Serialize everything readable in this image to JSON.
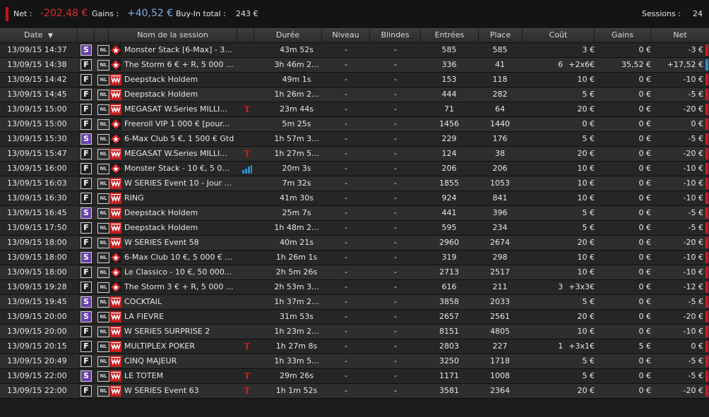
{
  "summary": {
    "net_label": "Net :",
    "net_value": "-202,48 €",
    "gains_label": "Gains :",
    "gains_value": "+40,52 €",
    "buyin_label": "Buy-In total :",
    "buyin_value": "243 €",
    "sessions_label": "Sessions :",
    "sessions_value": "24"
  },
  "columns": {
    "date": "Date",
    "sort_icon": "▼",
    "name": "Nom de la session",
    "duration": "Durée",
    "level": "Niveau",
    "blinds": "Blindes",
    "entries": "Entrées",
    "place": "Place",
    "cost": "Coût",
    "gains": "Gains",
    "net": "Net"
  },
  "colors": {
    "negative": "#d21c1c",
    "positive": "#2a8fd6",
    "special_badge": "#6a40a8"
  },
  "rows": [
    {
      "date": "13/09/15 14:37",
      "type": "S",
      "nl": "NL",
      "room": "pokerstars-icon",
      "name": "Monster Stack [6-Max] - 3...",
      "flag": "",
      "duration": "43m 52s",
      "level": "-",
      "blinds": "-",
      "entries": "585",
      "place": "585",
      "cost_prefix": "",
      "cost": "3 €",
      "gains": "0 €",
      "net": "-3 €",
      "net_bar": "red"
    },
    {
      "date": "13/09/15 14:38",
      "type": "F",
      "nl": "NL",
      "room": "pokerstars-icon",
      "name": "The Storm 6 € + R, 5 000 ...",
      "flag": "",
      "duration": "3h 46m 2...",
      "level": "-",
      "blinds": "-",
      "entries": "336",
      "place": "41",
      "cost_prefix": "6",
      "cost": "+2x6€",
      "gains": "35,52 €",
      "net": "+17,52 €",
      "net_bar": "blue"
    },
    {
      "date": "13/09/15 14:42",
      "type": "F",
      "nl": "NL",
      "room": "winamax-icon",
      "name": "Deepstack Holdem",
      "flag": "",
      "duration": "49m 1s",
      "level": "-",
      "blinds": "-",
      "entries": "153",
      "place": "118",
      "cost_prefix": "",
      "cost": "10 €",
      "gains": "0 €",
      "net": "-10 €",
      "net_bar": "red"
    },
    {
      "date": "13/09/15 14:45",
      "type": "F",
      "nl": "NL",
      "room": "winamax-icon",
      "name": "Deepstack Holdem",
      "flag": "",
      "duration": "1h 26m 2...",
      "level": "-",
      "blinds": "-",
      "entries": "444",
      "place": "282",
      "cost_prefix": "",
      "cost": "5 €",
      "gains": "0 €",
      "net": "-5 €",
      "net_bar": "red"
    },
    {
      "date": "13/09/15 15:00",
      "type": "F",
      "nl": "NL",
      "room": "winamax-icon",
      "name": "MEGASAT W.Series MILLI...",
      "flag": "T",
      "duration": "23m 44s",
      "level": "-",
      "blinds": "-",
      "entries": "71",
      "place": "64",
      "cost_prefix": "",
      "cost": "20 €",
      "gains": "0 €",
      "net": "-20 €",
      "net_bar": "red"
    },
    {
      "date": "13/09/15 15:00",
      "type": "F",
      "nl": "NL",
      "room": "pokerstars-icon",
      "name": "Freeroll VIP 1 000 € [pour...",
      "flag": "",
      "duration": "5m 25s",
      "level": "-",
      "blinds": "-",
      "entries": "1456",
      "place": "1440",
      "cost_prefix": "",
      "cost": "0 €",
      "gains": "0 €",
      "net": "0 €",
      "net_bar": "red"
    },
    {
      "date": "13/09/15 15:30",
      "type": "S",
      "nl": "NL",
      "room": "pokerstars-icon",
      "name": "6-Max Club 5 €, 1 500 € Gtd",
      "flag": "",
      "duration": "1h 57m 3...",
      "level": "-",
      "blinds": "-",
      "entries": "229",
      "place": "176",
      "cost_prefix": "",
      "cost": "5 €",
      "gains": "0 €",
      "net": "-5 €",
      "net_bar": "red"
    },
    {
      "date": "13/09/15 15:47",
      "type": "F",
      "nl": "NL",
      "room": "winamax-icon",
      "name": "MEGASAT W.Series MILLI...",
      "flag": "T",
      "duration": "1h 27m 5...",
      "level": "-",
      "blinds": "-",
      "entries": "124",
      "place": "38",
      "cost_prefix": "",
      "cost": "20 €",
      "gains": "0 €",
      "net": "-20 €",
      "net_bar": "red"
    },
    {
      "date": "13/09/15 16:00",
      "type": "F",
      "nl": "NL",
      "room": "pokerstars-icon",
      "name": "Monster Stack - 10 €, 5 0...",
      "flag": "chart",
      "duration": "20m 3s",
      "level": "-",
      "blinds": "-",
      "entries": "206",
      "place": "206",
      "cost_prefix": "",
      "cost": "10 €",
      "gains": "0 €",
      "net": "-10 €",
      "net_bar": "red"
    },
    {
      "date": "13/09/15 16:03",
      "type": "F",
      "nl": "NL",
      "room": "winamax-icon",
      "name": "W SERIES Event 10 - Jour ...",
      "flag": "",
      "duration": "7m 32s",
      "level": "-",
      "blinds": "-",
      "entries": "1855",
      "place": "1053",
      "cost_prefix": "",
      "cost": "10 €",
      "gains": "0 €",
      "net": "-10 €",
      "net_bar": "red"
    },
    {
      "date": "13/09/15 16:30",
      "type": "F",
      "nl": "NL",
      "room": "winamax-icon",
      "name": "RING",
      "flag": "",
      "duration": "41m 30s",
      "level": "-",
      "blinds": "-",
      "entries": "924",
      "place": "841",
      "cost_prefix": "",
      "cost": "10 €",
      "gains": "0 €",
      "net": "-10 €",
      "net_bar": "red"
    },
    {
      "date": "13/09/15 16:45",
      "type": "S",
      "nl": "NL",
      "room": "winamax-icon",
      "name": "Deepstack Holdem",
      "flag": "",
      "duration": "25m 7s",
      "level": "-",
      "blinds": "-",
      "entries": "441",
      "place": "396",
      "cost_prefix": "",
      "cost": "5 €",
      "gains": "0 €",
      "net": "-5 €",
      "net_bar": "red"
    },
    {
      "date": "13/09/15 17:50",
      "type": "F",
      "nl": "NL",
      "room": "winamax-icon",
      "name": "Deepstack Holdem",
      "flag": "",
      "duration": "1h 48m 2...",
      "level": "-",
      "blinds": "-",
      "entries": "595",
      "place": "234",
      "cost_prefix": "",
      "cost": "5 €",
      "gains": "0 €",
      "net": "-5 €",
      "net_bar": "red"
    },
    {
      "date": "13/09/15 18:00",
      "type": "F",
      "nl": "NL",
      "room": "winamax-icon",
      "name": "W SERIES Event 58",
      "flag": "",
      "duration": "40m 21s",
      "level": "-",
      "blinds": "-",
      "entries": "2960",
      "place": "2674",
      "cost_prefix": "",
      "cost": "20 €",
      "gains": "0 €",
      "net": "-20 €",
      "net_bar": "red"
    },
    {
      "date": "13/09/15 18:00",
      "type": "S",
      "nl": "NL",
      "room": "pokerstars-icon",
      "name": "6-Max Club 10 €, 5 000 € ...",
      "flag": "",
      "duration": "1h 26m 1s",
      "level": "-",
      "blinds": "-",
      "entries": "319",
      "place": "298",
      "cost_prefix": "",
      "cost": "10 €",
      "gains": "0 €",
      "net": "-10 €",
      "net_bar": "red"
    },
    {
      "date": "13/09/15 18:00",
      "type": "F",
      "nl": "NL",
      "room": "pokerstars-icon",
      "name": "Le Classico - 10 €, 50 000...",
      "flag": "",
      "duration": "2h 5m 26s",
      "level": "-",
      "blinds": "-",
      "entries": "2713",
      "place": "2517",
      "cost_prefix": "",
      "cost": "10 €",
      "gains": "0 €",
      "net": "-10 €",
      "net_bar": "red"
    },
    {
      "date": "13/09/15 19:28",
      "type": "F",
      "nl": "NL",
      "room": "pokerstars-icon",
      "name": "The Storm 3 € + R, 5 000 ...",
      "flag": "",
      "duration": "2h 53m 3...",
      "level": "-",
      "blinds": "-",
      "entries": "616",
      "place": "211",
      "cost_prefix": "3",
      "cost": "+3x3€",
      "gains": "0 €",
      "net": "-12 €",
      "net_bar": "red"
    },
    {
      "date": "13/09/15 19:45",
      "type": "S",
      "nl": "NL",
      "room": "winamax-icon",
      "name": "COCKTAIL",
      "flag": "",
      "duration": "1h 37m 2...",
      "level": "-",
      "blinds": "-",
      "entries": "3858",
      "place": "2033",
      "cost_prefix": "",
      "cost": "5 €",
      "gains": "0 €",
      "net": "-5 €",
      "net_bar": "red"
    },
    {
      "date": "13/09/15 20:00",
      "type": "S",
      "nl": "NL",
      "room": "winamax-icon",
      "name": "LA FIEVRE",
      "flag": "",
      "duration": "31m 53s",
      "level": "-",
      "blinds": "-",
      "entries": "2657",
      "place": "2561",
      "cost_prefix": "",
      "cost": "20 €",
      "gains": "0 €",
      "net": "-20 €",
      "net_bar": "red"
    },
    {
      "date": "13/09/15 20:00",
      "type": "F",
      "nl": "NL",
      "room": "winamax-icon",
      "name": "W SERIES SURPRISE 2",
      "flag": "",
      "duration": "1h 23m 2...",
      "level": "-",
      "blinds": "-",
      "entries": "8151",
      "place": "4805",
      "cost_prefix": "",
      "cost": "10 €",
      "gains": "0 €",
      "net": "-10 €",
      "net_bar": "red"
    },
    {
      "date": "13/09/15 20:15",
      "type": "F",
      "nl": "NL",
      "room": "winamax-icon",
      "name": "MULTIPLEX POKER",
      "flag": "T",
      "duration": "1h 27m 8s",
      "level": "-",
      "blinds": "-",
      "entries": "2803",
      "place": "227",
      "cost_prefix": "1",
      "cost": "+3x1€",
      "gains": "5 €",
      "net": "0 €",
      "net_bar": "red"
    },
    {
      "date": "13/09/15 20:49",
      "type": "F",
      "nl": "NL",
      "room": "winamax-icon",
      "name": "CINQ MAJEUR",
      "flag": "",
      "duration": "1h 33m 5...",
      "level": "-",
      "blinds": "-",
      "entries": "3250",
      "place": "1718",
      "cost_prefix": "",
      "cost": "5 €",
      "gains": "0 €",
      "net": "-5 €",
      "net_bar": "red"
    },
    {
      "date": "13/09/15 22:00",
      "type": "S",
      "nl": "NL",
      "room": "winamax-icon",
      "name": "LE TOTEM",
      "flag": "T",
      "duration": "29m 26s",
      "level": "-",
      "blinds": "-",
      "entries": "1171",
      "place": "1008",
      "cost_prefix": "",
      "cost": "5 €",
      "gains": "0 €",
      "net": "-5 €",
      "net_bar": "red"
    },
    {
      "date": "13/09/15 22:00",
      "type": "F",
      "nl": "NL",
      "room": "winamax-icon",
      "name": "W SERIES Event 63",
      "flag": "T",
      "duration": "1h 1m 52s",
      "level": "-",
      "blinds": "-",
      "entries": "3581",
      "place": "2364",
      "cost_prefix": "",
      "cost": "20 €",
      "gains": "0 €",
      "net": "-20 €",
      "net_bar": "red"
    }
  ]
}
